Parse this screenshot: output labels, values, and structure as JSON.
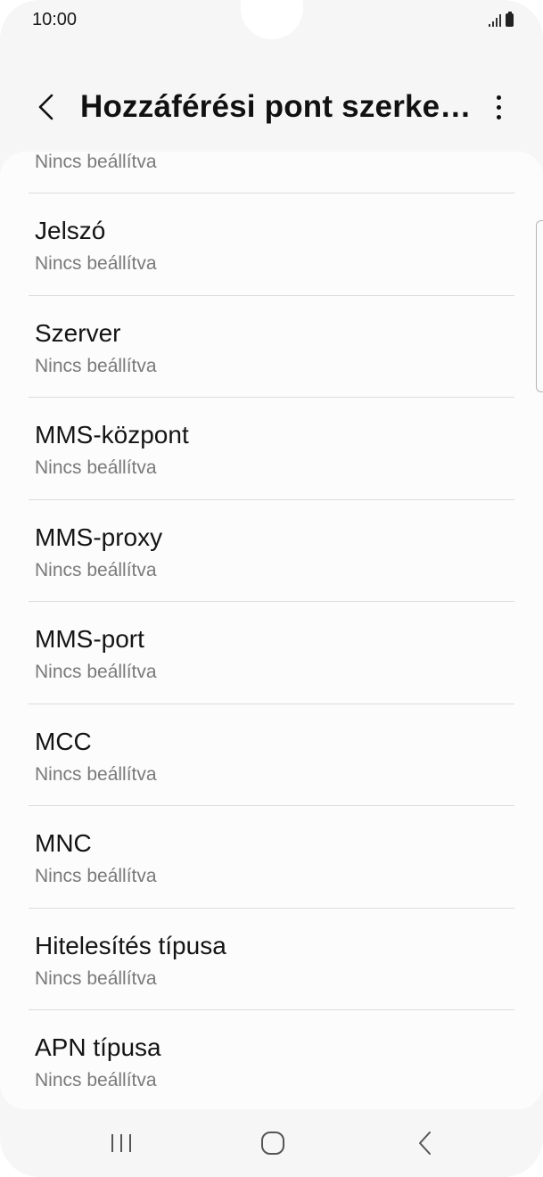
{
  "status_bar": {
    "time": "10:00",
    "icons": [
      "signal-icon",
      "battery-icon"
    ]
  },
  "app_bar": {
    "title": "Hozzáférési pont szerkes...",
    "back_icon": "back-arrow-icon",
    "more_icon": "more-options-icon"
  },
  "list": {
    "first_partial_value": "Nincs beállítva",
    "items": [
      {
        "label": "Jelszó",
        "value": "Nincs beállítva"
      },
      {
        "label": "Szerver",
        "value": "Nincs beállítva"
      },
      {
        "label": "MMS-központ",
        "value": "Nincs beállítva"
      },
      {
        "label": "MMS-proxy",
        "value": "Nincs beállítva"
      },
      {
        "label": "MMS-port",
        "value": "Nincs beállítva"
      },
      {
        "label": "MCC",
        "value": "Nincs beállítva"
      },
      {
        "label": "MNC",
        "value": "Nincs beállítva"
      },
      {
        "label": "Hitelesítés típusa",
        "value": "Nincs beállítva"
      },
      {
        "label": "APN típusa",
        "value": "Nincs beállítva"
      }
    ]
  },
  "nav_bar": {
    "icons": [
      "recent-apps-icon",
      "home-icon",
      "back-icon"
    ]
  },
  "colors": {
    "background": "#f6f6f6",
    "card": "#fcfcfc",
    "primary_text": "#141414",
    "secondary_text": "#7a7a7a",
    "divider": "#dcdcdc"
  }
}
